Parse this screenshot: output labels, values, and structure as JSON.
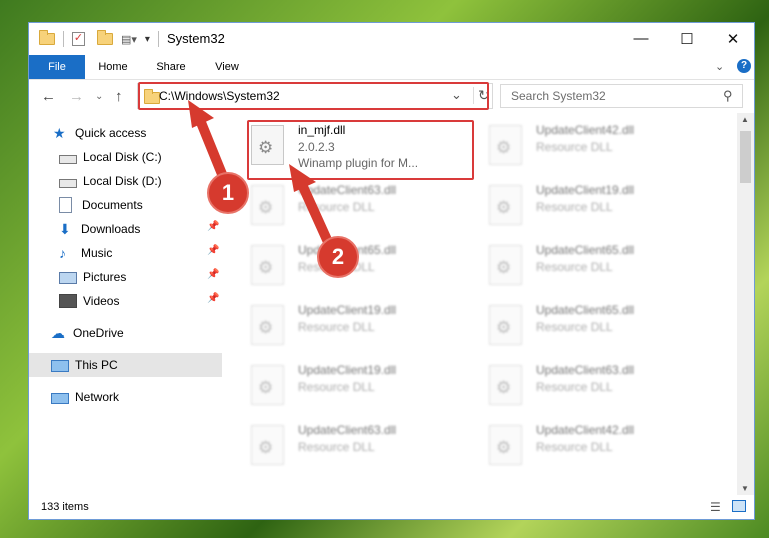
{
  "window": {
    "title": "System32"
  },
  "controls": {
    "minimize": "—",
    "maximize": "☐",
    "close": "✕"
  },
  "ribbon": {
    "tabs": [
      "File",
      "Home",
      "Share",
      "View"
    ]
  },
  "address": {
    "path": "C:\\Windows\\System32"
  },
  "search": {
    "placeholder": "Search System32"
  },
  "sidebar": {
    "quick_access": "Quick access",
    "items": [
      "Local Disk (C:)",
      "Local Disk (D:)",
      "Documents",
      "Downloads",
      "Music",
      "Pictures",
      "Videos"
    ],
    "onedrive": "OneDrive",
    "thispc": "This PC",
    "network": "Network"
  },
  "highlighted_file": {
    "name": "in_mjf.dll",
    "version": "2.0.2.3",
    "description": "Winamp plugin for M..."
  },
  "files_left": [
    {
      "name": "UpdateClient63.dll",
      "type": "Resource DLL"
    },
    {
      "name": "UpdateClient65.dll",
      "type": "Resource DLL"
    },
    {
      "name": "UpdateClient19.dll",
      "type": "Resource DLL"
    },
    {
      "name": "UpdateClient19.dll",
      "type": "Resource DLL"
    },
    {
      "name": "UpdateClient63.dll",
      "type": "Resource DLL"
    }
  ],
  "files_right": [
    {
      "name": "UpdateClient42.dll",
      "type": "Resource DLL"
    },
    {
      "name": "UpdateClient19.dll",
      "type": "Resource DLL"
    },
    {
      "name": "UpdateClient65.dll",
      "type": "Resource DLL"
    },
    {
      "name": "UpdateClient65.dll",
      "type": "Resource DLL"
    },
    {
      "name": "UpdateClient63.dll",
      "type": "Resource DLL"
    },
    {
      "name": "UpdateClient42.dll",
      "type": "Resource DLL"
    }
  ],
  "status": {
    "count": "133 items"
  },
  "annotations": {
    "step1": "1",
    "step2": "2"
  },
  "colors": {
    "accent": "#1a6ec6",
    "highlight": "#d93a3a"
  }
}
